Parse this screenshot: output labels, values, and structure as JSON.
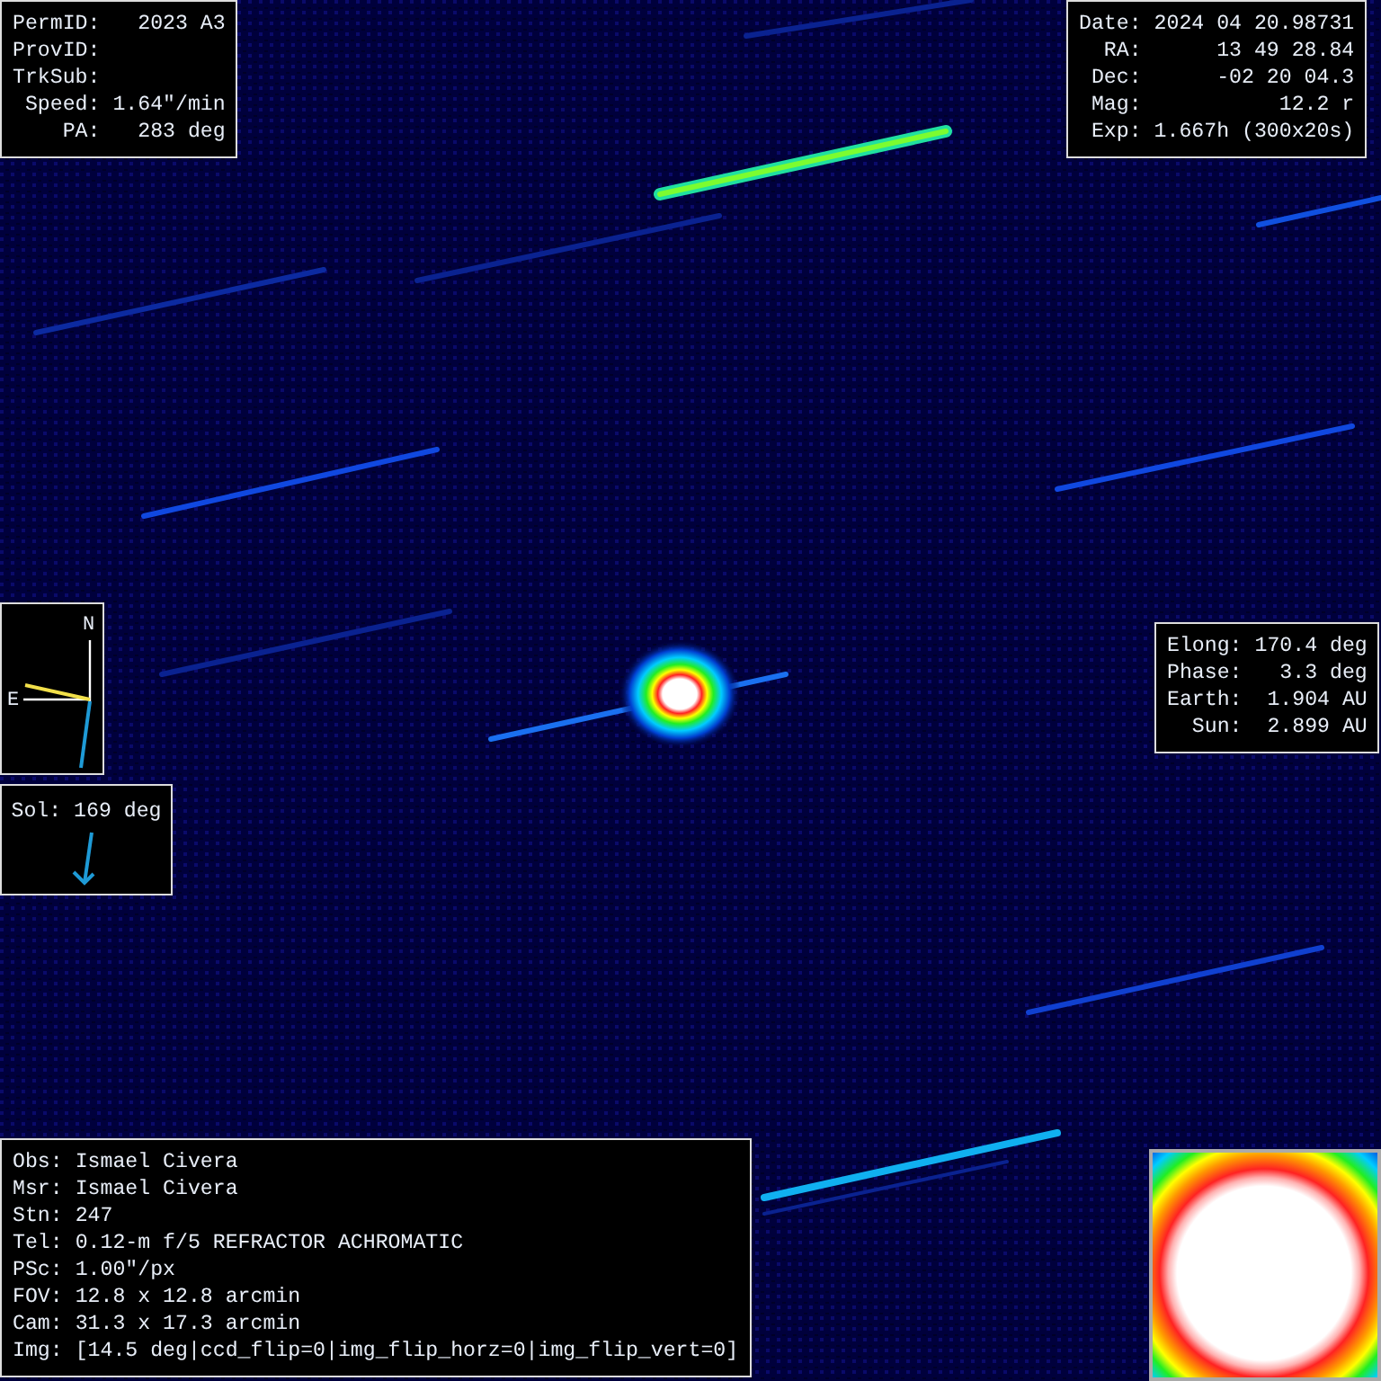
{
  "object_panel": {
    "rows": [
      {
        "label": "PermID:",
        "value": "2023 A3"
      },
      {
        "label": "ProvID:",
        "value": ""
      },
      {
        "label": "TrkSub:",
        "value": ""
      },
      {
        "label": "Speed:",
        "value": "1.64\"/min"
      },
      {
        "label": "PA:",
        "value": "283 deg"
      }
    ]
  },
  "observation_panel": {
    "rows": [
      {
        "label": "Date:",
        "value": "2024 04 20.98731"
      },
      {
        "label": "RA:",
        "value": "13 49 28.84"
      },
      {
        "label": "Dec:",
        "value": "-02 20 04.3"
      },
      {
        "label": "Mag:",
        "value": "12.2 r"
      },
      {
        "label": "Exp:",
        "value": "1.667h (300x20s)"
      }
    ]
  },
  "compass": {
    "north": "N",
    "east": "E"
  },
  "sun_direction": {
    "text": "Sol: 169 deg"
  },
  "geometry_panel": {
    "rows": [
      {
        "label": "Elong:",
        "value": "170.4 deg"
      },
      {
        "label": "Phase:",
        "value": "3.3 deg"
      },
      {
        "label": "Earth:",
        "value": "1.904 AU"
      },
      {
        "label": "Sun:",
        "value": "2.899 AU"
      }
    ]
  },
  "station_panel": {
    "rows": [
      {
        "label": "Obs:",
        "value": "Ismael Civera"
      },
      {
        "label": "Msr:",
        "value": "Ismael Civera"
      },
      {
        "label": "Stn:",
        "value": "247"
      },
      {
        "label": "Tel:",
        "value": "0.12-m f/5 REFRACTOR ACHROMATIC"
      },
      {
        "label": "PSc:",
        "value": "1.00\"/px"
      },
      {
        "label": "FOV:",
        "value": "12.8 x 12.8 arcmin"
      },
      {
        "label": "Cam:",
        "value": "31.3 x 17.3 arcmin"
      },
      {
        "label": "Img:",
        "value": "[14.5 deg|ccd_flip=0|img_flip_horz=0|img_flip_vert=0]"
      }
    ]
  }
}
